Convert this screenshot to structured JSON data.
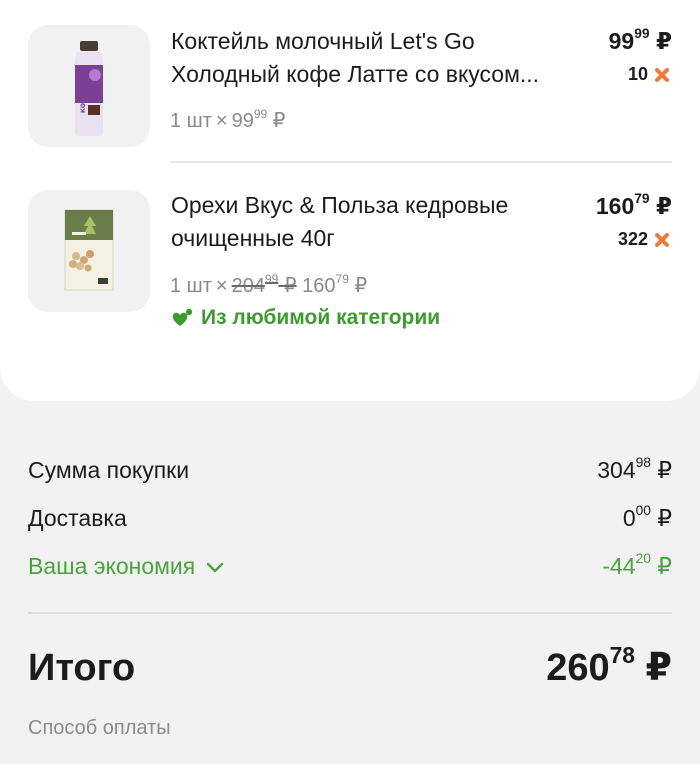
{
  "colors": {
    "accent_green": "#4aa43c",
    "favorite_green": "#3e9b2f",
    "bonus_cross_orange": "#f07a3a",
    "text": "#1c1c1c",
    "muted": "#8a8a8a"
  },
  "items": [
    {
      "name_line1": "Коктейль молочный Let's Go",
      "name_line2": "Холодный кофе Латте со вкусом...",
      "qty_count": "1 шт",
      "qty_x": "×",
      "unit_price_main": "99",
      "unit_price_cents": "99",
      "unit_price_currency": "₽",
      "price_main": "99",
      "price_cents": "99",
      "price_currency": "₽",
      "bonus": "10",
      "bonus_icon": "bonus-cross-icon",
      "thumb_icon": "milkshake-bottle-image",
      "thumb_label": "КОФЕ ЛАТТЕ"
    },
    {
      "name_line1": "Орехи Вкус & Польза кедровые",
      "name_line2": "очищенные 40г",
      "qty_count": "1 шт",
      "qty_x": "×",
      "old_price_main": "204",
      "old_price_cents": "99",
      "old_price_currency": "₽",
      "unit_price_main": "160",
      "unit_price_cents": "79",
      "unit_price_currency": "₽",
      "price_main": "160",
      "price_cents": "79",
      "price_currency": "₽",
      "bonus": "322",
      "bonus_icon": "bonus-cross-icon",
      "thumb_icon": "pine-nuts-pack-image",
      "badge": "Из любимой категории",
      "badge_icon": "favorite-category-icon"
    }
  ],
  "summary": {
    "purchase_label": "Сумма покупки",
    "purchase_main": "304",
    "purchase_cents": "98",
    "purchase_currency": "₽",
    "delivery_label": "Доставка",
    "delivery_main": "0",
    "delivery_cents": "00",
    "delivery_currency": "₽",
    "savings_label": "Ваша экономия",
    "savings_icon": "chevron-down-icon",
    "savings_main": "-44",
    "savings_cents": "20",
    "savings_currency": "₽"
  },
  "total": {
    "label": "Итого",
    "main": "260",
    "cents": "78",
    "currency": "₽"
  },
  "payment": {
    "label": "Способ оплаты"
  }
}
